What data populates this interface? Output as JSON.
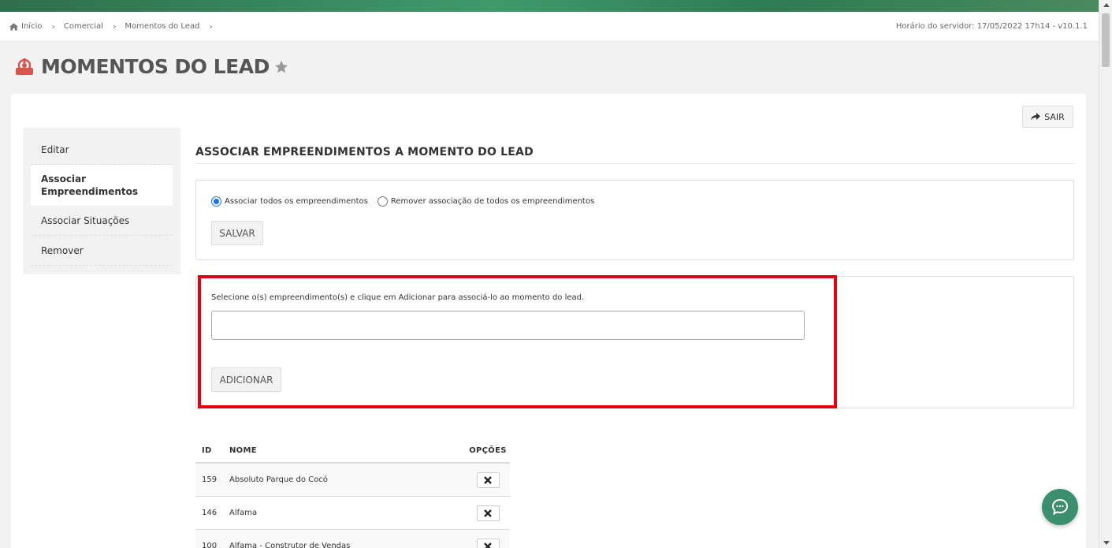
{
  "breadcrumb": {
    "items": [
      {
        "label": "Início"
      },
      {
        "label": "Comercial"
      },
      {
        "label": "Momentos do Lead"
      }
    ]
  },
  "server_time": "Horário do servidor: 17/05/2022 17h14 - v10.1.1",
  "page": {
    "title": "MOMENTOS DO LEAD"
  },
  "toolbar": {
    "sair_label": "SAIR"
  },
  "side_menu": {
    "items": [
      {
        "label": "Editar"
      },
      {
        "label": "Associar Empreendimentos"
      },
      {
        "label": "Associar Situações"
      },
      {
        "label": "Remover"
      }
    ]
  },
  "section": {
    "title": "ASSOCIAR EMPREENDIMENTOS A MOMENTO DO LEAD"
  },
  "radios": {
    "associate_all": "Associar todos os empreendimentos",
    "remove_all": "Remover associação de todos os empreendimentos",
    "selected": "associate_all"
  },
  "save_button": "SALVAR",
  "add_panel": {
    "hint": "Selecione o(s) empreendimento(s) e clique em Adicionar para associá-lo ao momento do lead.",
    "input_value": "",
    "add_button": "ADICIONAR"
  },
  "table": {
    "headers": {
      "id": "ID",
      "nome": "NOME",
      "opcoes": "OPÇÕES"
    },
    "rows": [
      {
        "id": "159",
        "nome": "Absoluto Parque do Cocó"
      },
      {
        "id": "146",
        "nome": "Alfama"
      },
      {
        "id": "100",
        "nome": "Alfama - Construtor de Vendas"
      }
    ]
  },
  "colors": {
    "highlight": "#e4000f",
    "accent": "#3c8f6e",
    "radio": "#1a73e8"
  },
  "icons": {
    "home": "home-icon",
    "page": "page-icon",
    "favorite": "star-icon",
    "exit": "share-arrow-icon",
    "delete": "close-icon",
    "chat": "chat-icon"
  }
}
